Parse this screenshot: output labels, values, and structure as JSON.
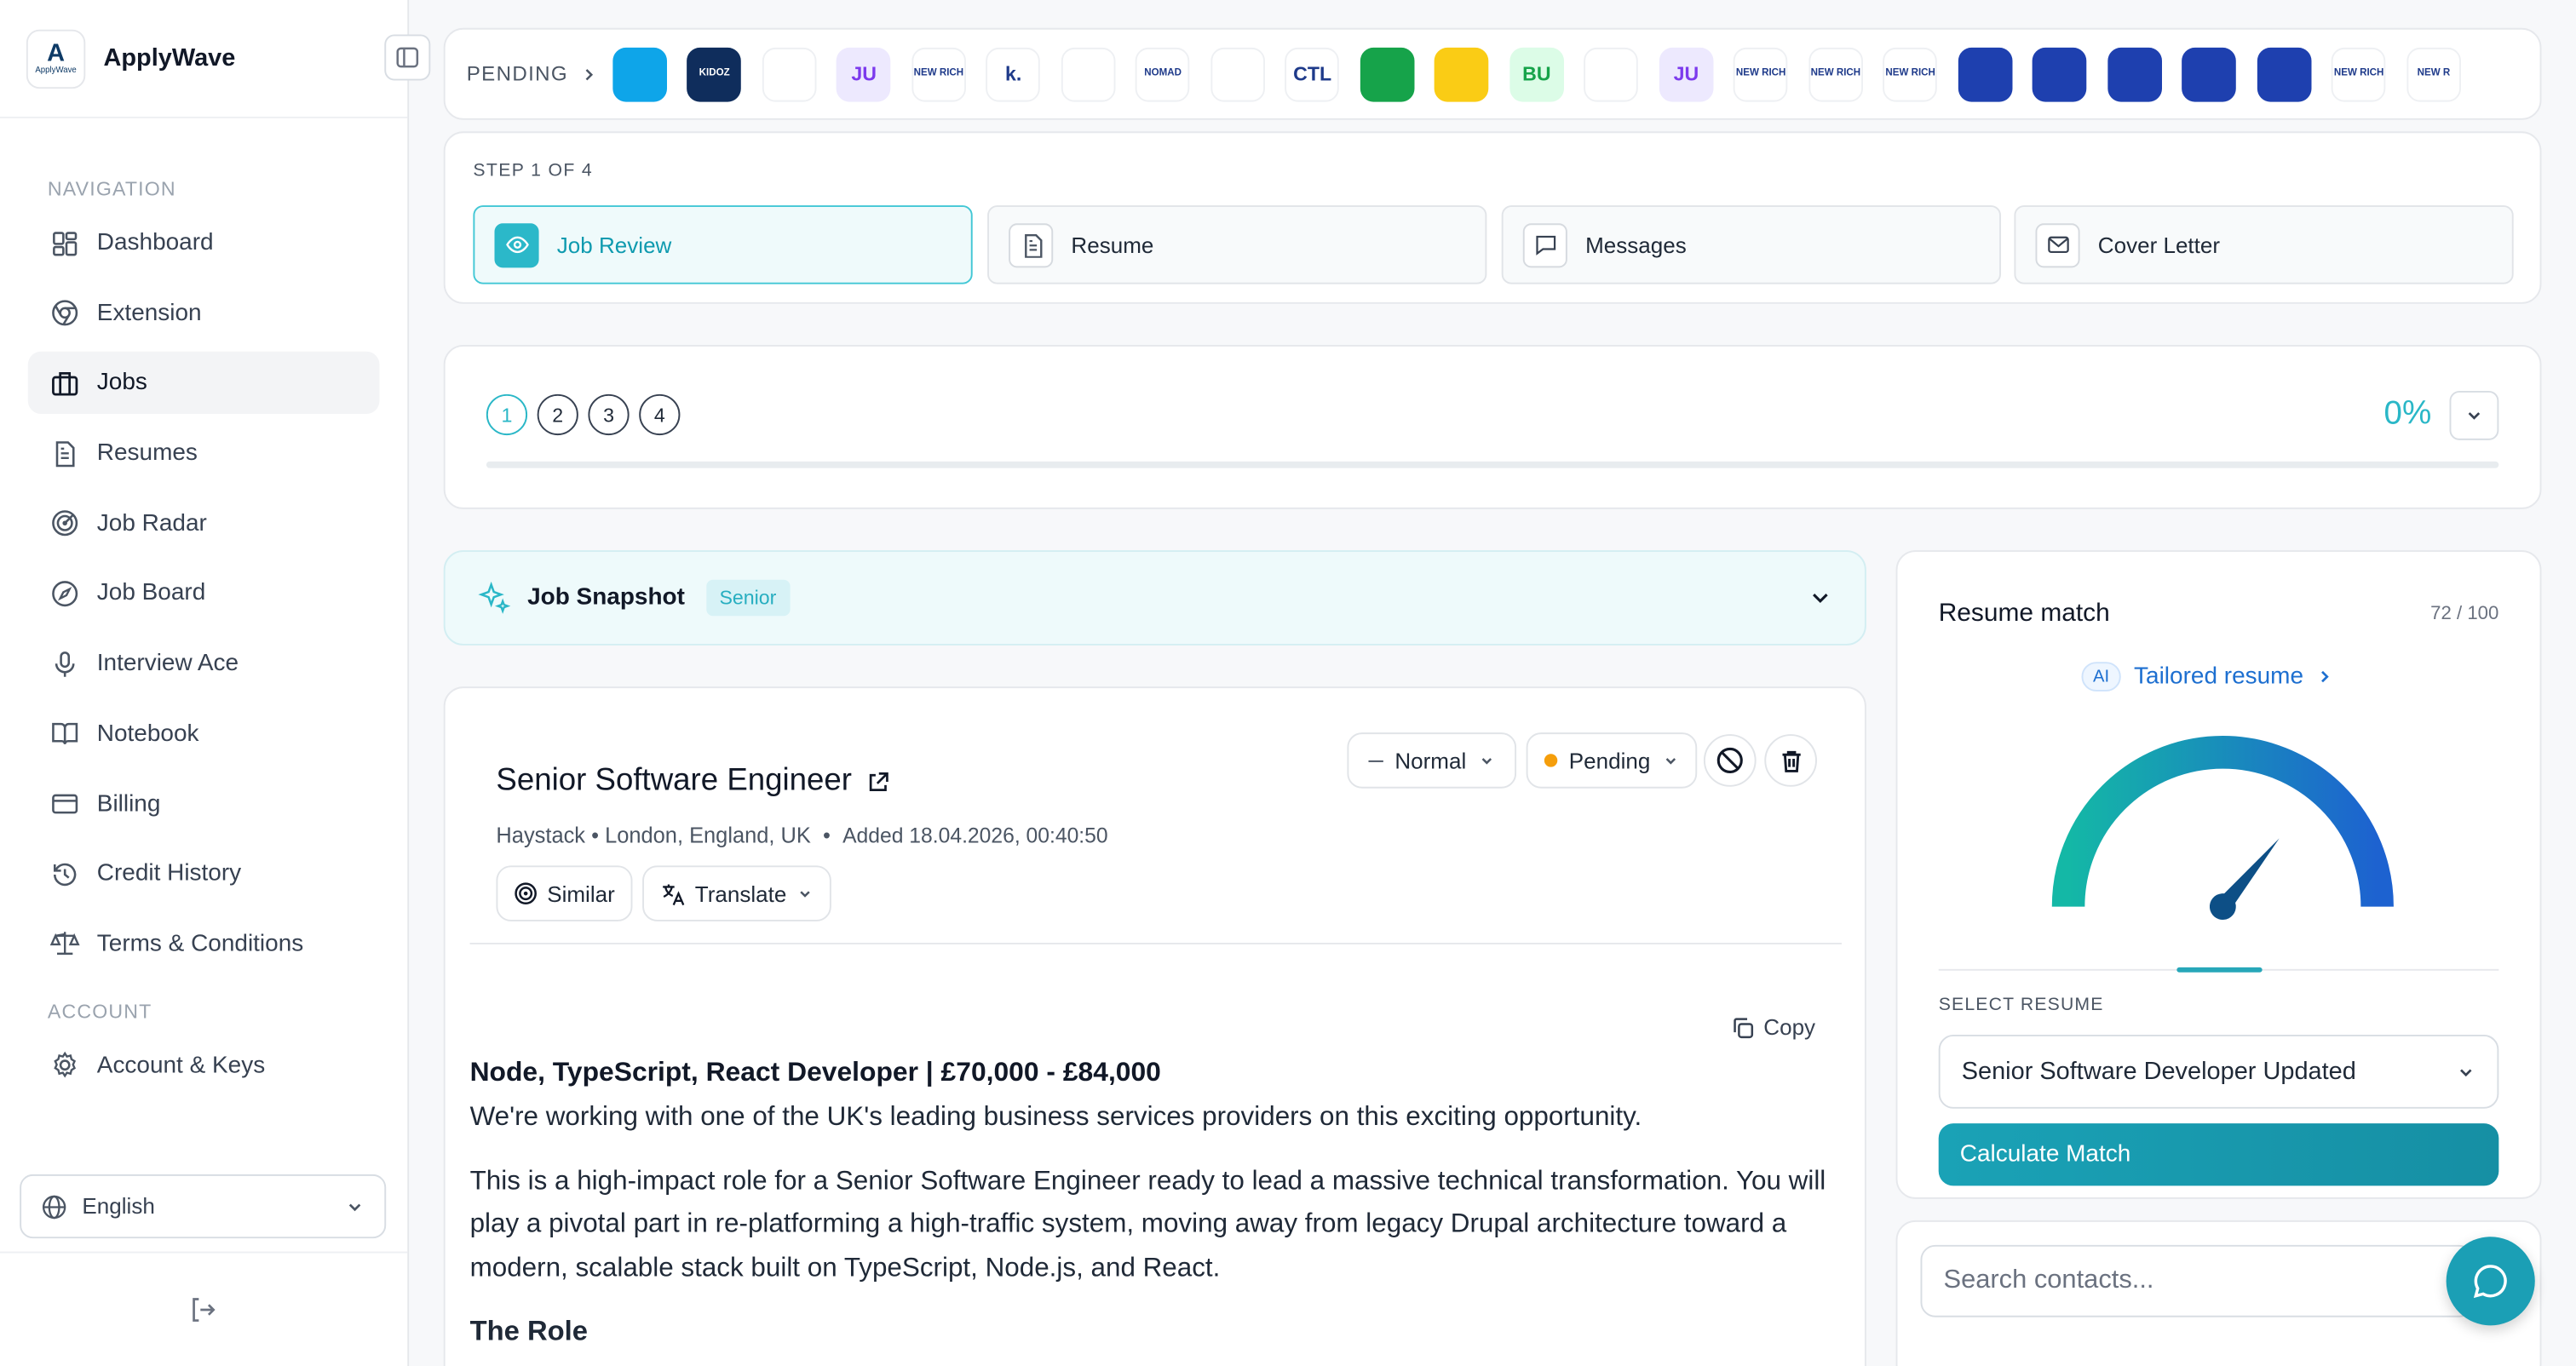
{
  "app": {
    "name": "ApplyWave",
    "logo_text": "ApplyWave"
  },
  "sidebar": {
    "navigation_heading": "NAVIGATION",
    "items": [
      {
        "label": "Dashboard",
        "icon": "dashboard-icon"
      },
      {
        "label": "Extension",
        "icon": "chrome-icon"
      },
      {
        "label": "Jobs",
        "icon": "briefcase-icon",
        "active": true
      },
      {
        "label": "Resumes",
        "icon": "document-icon"
      },
      {
        "label": "Job Radar",
        "icon": "radar-icon"
      },
      {
        "label": "Job Board",
        "icon": "compass-icon"
      },
      {
        "label": "Interview Ace",
        "icon": "microphone-icon"
      },
      {
        "label": "Notebook",
        "icon": "book-icon"
      },
      {
        "label": "Billing",
        "icon": "credit-card-icon"
      },
      {
        "label": "Credit History",
        "icon": "history-icon"
      },
      {
        "label": "Terms & Conditions",
        "icon": "scale-icon"
      }
    ],
    "account_heading": "ACCOUNT",
    "account_items": [
      {
        "label": "Account & Keys",
        "icon": "gear-icon"
      }
    ],
    "language": "English"
  },
  "tray": {
    "label": "PENDING",
    "companies": [
      {
        "icon": "company-logo-db",
        "text": "",
        "bg": "#0ea5e9"
      },
      {
        "icon": "company-logo-kidoz",
        "text": "KIDOZ",
        "bg": "#0f2d5c"
      },
      {
        "icon": "company-logo-orange-swirl",
        "text": "",
        "bg": "#ffffff"
      },
      {
        "icon": "company-logo-initials",
        "text": "JU",
        "bg": "#ede9fe"
      },
      {
        "icon": "company-logo-new-rich",
        "text": "NEW RICH",
        "bg": "#ffffff"
      },
      {
        "icon": "company-logo-k",
        "text": "k.",
        "bg": "#ffffff"
      },
      {
        "icon": "company-logo-haystack",
        "text": "",
        "bg": "#f7941d",
        "selected": true
      },
      {
        "icon": "company-logo-pen",
        "text": "",
        "bg": "#ffffff"
      },
      {
        "icon": "company-logo-nomad",
        "text": "NOMAD",
        "bg": "#ffffff"
      },
      {
        "icon": "company-logo-v-shape",
        "text": "",
        "bg": "#ffffff"
      },
      {
        "icon": "company-logo-ctl",
        "text": "CTL",
        "bg": "#ffffff"
      },
      {
        "icon": "company-logo-hex",
        "text": "",
        "bg": "#16a34a"
      },
      {
        "icon": "company-logo-yellow",
        "text": "",
        "bg": "#facc15"
      },
      {
        "icon": "company-logo-initials",
        "text": "BU",
        "bg": "#dcfce7"
      },
      {
        "icon": "company-logo-blocks",
        "text": "",
        "bg": "#ffffff"
      },
      {
        "icon": "company-logo-initials",
        "text": "JU",
        "bg": "#ede9fe"
      },
      {
        "icon": "company-logo-new-rich",
        "text": "NEW RICH",
        "bg": "#ffffff"
      },
      {
        "icon": "company-logo-new-rich",
        "text": "NEW RICH",
        "bg": "#ffffff"
      },
      {
        "icon": "company-logo-new-rich",
        "text": "NEW RICH",
        "bg": "#ffffff"
      },
      {
        "icon": "company-logo-shield",
        "text": "",
        "bg": "#1e40af"
      },
      {
        "icon": "company-logo-shield",
        "text": "",
        "bg": "#1e40af"
      },
      {
        "icon": "company-logo-shield",
        "text": "",
        "bg": "#1e40af"
      },
      {
        "icon": "company-logo-shield",
        "text": "",
        "bg": "#1e40af"
      },
      {
        "icon": "company-logo-shield",
        "text": "",
        "bg": "#1e40af"
      },
      {
        "icon": "company-logo-new-rich",
        "text": "NEW RICH",
        "bg": "#ffffff"
      },
      {
        "icon": "company-logo-new-rich",
        "text": "NEW R",
        "bg": "#ffffff"
      }
    ]
  },
  "steps": {
    "caption": "STEP 1 OF 4",
    "items": [
      {
        "label": "Job Review",
        "icon": "eye-icon",
        "active": true
      },
      {
        "label": "Resume",
        "icon": "document-icon"
      },
      {
        "label": "Messages",
        "icon": "message-icon"
      },
      {
        "label": "Cover Letter",
        "icon": "mail-icon"
      }
    ]
  },
  "progress": {
    "steps": [
      "1",
      "2",
      "3",
      "4"
    ],
    "current": 1,
    "percent_label": "0%",
    "percent": 0
  },
  "snapshot": {
    "title": "Job Snapshot",
    "badge": "Senior"
  },
  "job": {
    "title": "Senior Software Engineer",
    "company": "Haystack",
    "location": "London, England, UK",
    "added": "Added 18.04.2026, 00:40:50",
    "priority": "Normal",
    "status": "Pending",
    "status_color": "#f59e0b",
    "similar_label": "Similar",
    "translate_label": "Translate",
    "copy_label": "Copy",
    "headline": "Node, TypeScript, React Developer | £70,000 - £84,000",
    "intro": "We're working with one of the UK's leading business services providers on this exciting opportunity.",
    "para": "This is a high-impact role for a Senior Software Engineer ready to lead a massive technical transformation. You will play a pivotal part in re-platforming a high-traffic system, moving away from legacy Drupal architecture toward a modern, scalable stack built on TypeScript, Node.js, and React.",
    "section": "The Role"
  },
  "match": {
    "title": "Resume match",
    "score": "72 / 100",
    "score_value": 72,
    "ai_badge": "AI",
    "tailored_label": "Tailored resume",
    "select_label": "SELECT RESUME",
    "selected_resume": "Senior Software Developer Updated",
    "calculate_label": "Calculate Match"
  },
  "contacts": {
    "search_placeholder": "Search contacts..."
  },
  "colors": {
    "accent": "#2ab7c7",
    "link": "#1d6fd0",
    "gauge_start": "#14b8a6",
    "gauge_end": "#1d62d0"
  }
}
